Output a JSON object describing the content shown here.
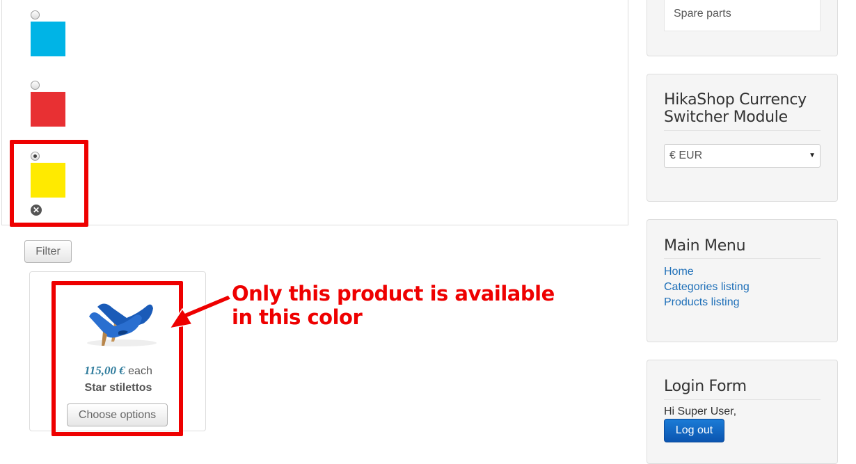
{
  "filter": {
    "options": [
      {
        "color_name": "cyan",
        "color": "#00b4e6",
        "selected": false
      },
      {
        "color_name": "red",
        "color": "#e83033",
        "selected": false
      },
      {
        "color_name": "yellow",
        "color": "#ffea00",
        "selected": true
      }
    ],
    "clear_icon": "close-icon",
    "button_label": "Filter"
  },
  "product": {
    "image": "blue high heel shoes",
    "price": "115,00 €",
    "price_suffix": "each",
    "name": "Star stilettos",
    "button_label": "Choose options"
  },
  "annotation": {
    "line1": "Only this product is available",
    "line2": "in this color",
    "color": "#ee0000"
  },
  "sidebar": {
    "categories_last_item": "Spare parts",
    "currency": {
      "title_line1": "HikaShop Currency",
      "title_line2": "Switcher Module",
      "selected": "€ EUR"
    },
    "main_menu": {
      "title": "Main Menu",
      "items": [
        {
          "label": "Home"
        },
        {
          "label": "Categories listing"
        },
        {
          "label": "Products listing"
        }
      ]
    },
    "login": {
      "title": "Login Form",
      "greeting": "Hi Super User,",
      "logout_label": "Log out"
    }
  }
}
